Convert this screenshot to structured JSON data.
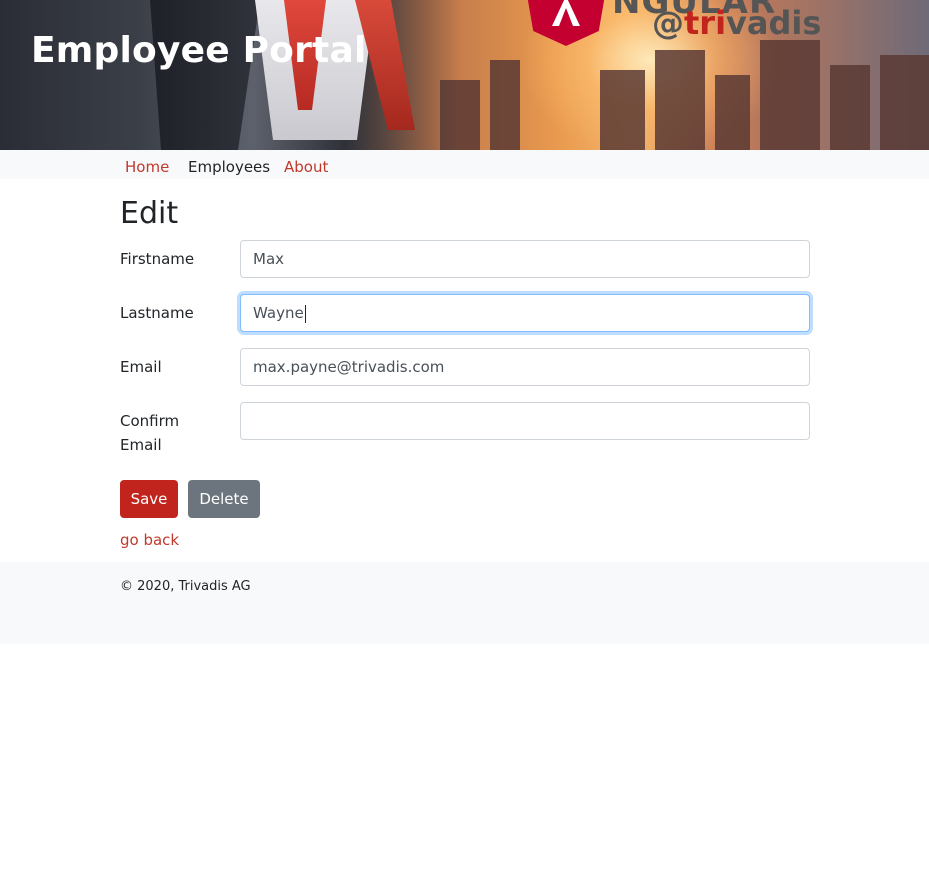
{
  "header": {
    "title": "Employee Portal",
    "logo_angular_word": "NGULAR",
    "logo_trivadis_at": "@",
    "logo_trivadis_accent": "tri",
    "logo_trivadis_rest": "vadis"
  },
  "nav": {
    "items": [
      {
        "label": "Home",
        "active": false
      },
      {
        "label": "Employees",
        "active": true
      },
      {
        "label": "About",
        "active": false
      }
    ]
  },
  "form": {
    "heading": "Edit",
    "fields": [
      {
        "label": "Firstname",
        "value": "Max",
        "focused": false
      },
      {
        "label": "Lastname",
        "value": "Wayne",
        "focused": true
      },
      {
        "label": "Email",
        "value": "max.payne@trivadis.com",
        "focused": false
      },
      {
        "label": "Confirm Email",
        "value": "",
        "focused": false
      }
    ],
    "save_label": "Save",
    "delete_label": "Delete",
    "go_back_label": "go back"
  },
  "footer": {
    "text": "© 2020, Trivadis AG"
  },
  "colors": {
    "accent": "#c0241c",
    "link": "#c0392b",
    "secondary": "#6c757d",
    "navbar_bg": "#f8f9fa"
  }
}
